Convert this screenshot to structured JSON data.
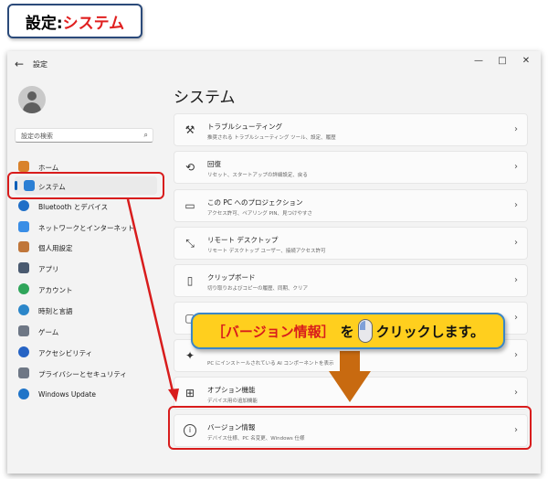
{
  "banner": {
    "prefix": "設定:",
    "suffix": "システム"
  },
  "window": {
    "title": "設定",
    "back": "←",
    "minimize": "—",
    "maximize": "□",
    "close": "✕"
  },
  "search": {
    "placeholder": "設定の検索",
    "icon": "search-icon"
  },
  "nav": [
    {
      "label": "ホーム",
      "icon": "home-icon",
      "color": "#d9822b"
    },
    {
      "label": "システム",
      "icon": "system-icon",
      "color": "#2b7fd4"
    },
    {
      "label": "Bluetooth とデバイス",
      "icon": "bluetooth-icon",
      "color": "#1f6fc7"
    },
    {
      "label": "ネットワークとインターネット",
      "icon": "network-icon",
      "color": "#3a8ee6"
    },
    {
      "label": "個人用設定",
      "icon": "personalize-icon",
      "color": "#c0763a"
    },
    {
      "label": "アプリ",
      "icon": "apps-icon",
      "color": "#4a5a70"
    },
    {
      "label": "アカウント",
      "icon": "account-icon",
      "color": "#2fa55a"
    },
    {
      "label": "時刻と言語",
      "icon": "time-language-icon",
      "color": "#2b86c9"
    },
    {
      "label": "ゲーム",
      "icon": "game-icon",
      "color": "#6e7785"
    },
    {
      "label": "アクセシビリティ",
      "icon": "accessibility-icon",
      "color": "#2563c4"
    },
    {
      "label": "プライバシーとセキュリティ",
      "icon": "shield-icon",
      "color": "#6e7785"
    },
    {
      "label": "Windows Update",
      "icon": "update-icon",
      "color": "#1f74c8"
    }
  ],
  "main": {
    "heading": "システム",
    "cards": [
      {
        "title": "トラブルシューティング",
        "sub": "推奨される トラブルシューティング ツール、設定、履歴",
        "icon": "wrench-icon"
      },
      {
        "title": "回復",
        "sub": "リセット、スタートアップの詳細設定、戻る",
        "icon": "recovery-icon"
      },
      {
        "title": "この PC へのプロジェクション",
        "sub": "アクセス許可、ペアリング PIN、見つけやすさ",
        "icon": "projection-icon"
      },
      {
        "title": "リモート デスクトップ",
        "sub": "リモート デスクトップ ユーザー、接続アクセス許可",
        "icon": "remote-desktop-icon"
      },
      {
        "title": "クリップボード",
        "sub": "切り取りおよびコピーの履歴、同期、クリア",
        "icon": "clipboard-icon"
      },
      {
        "title": "",
        "sub": "",
        "icon": "display-icon"
      },
      {
        "title": "",
        "sub": "PC にインストールされている AI コンポーネントを表示",
        "icon": "ai-icon"
      },
      {
        "title": "オプション機能",
        "sub": "デバイス用の追加機能",
        "icon": "optional-features-icon"
      },
      {
        "title": "バージョン情報",
        "sub": "デバイス仕様、PC 名変更、Windows 仕様",
        "icon": "info-icon"
      }
    ]
  },
  "callout": {
    "bracket_open": "［",
    "name": "バージョン情報",
    "bracket_close": "］",
    "particle": "を",
    "action": "クリックします。"
  },
  "chevron": "›"
}
